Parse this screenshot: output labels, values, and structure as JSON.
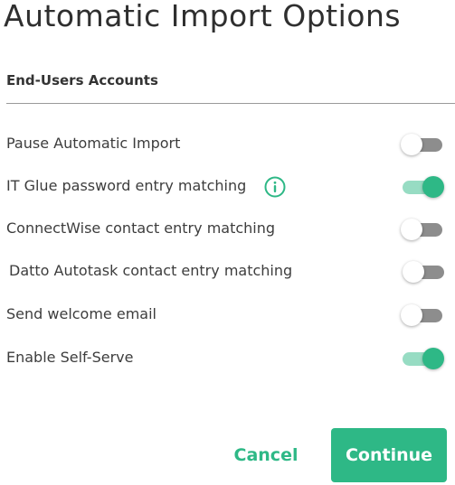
{
  "page": {
    "title": "Automatic Import Options",
    "section_heading": "End-Users Accounts"
  },
  "options": [
    {
      "label": "Pause Automatic Import",
      "state": "off"
    },
    {
      "label": "IT Glue password entry matching",
      "state": "on",
      "info_icon": "info-icon"
    },
    {
      "label": "ConnectWise contact entry matching",
      "state": "off"
    },
    {
      "label": "Datto Autotask contact entry matching",
      "state": "off"
    },
    {
      "label": "Send welcome email",
      "state": "off"
    },
    {
      "label": "Enable Self-Serve",
      "state": "on"
    }
  ],
  "actions": {
    "cancel_label": "Cancel",
    "continue_label": "Continue"
  },
  "colors": {
    "accent": "#2eb886",
    "accent_light": "#97dcc3",
    "toggle_off_track": "#8d8d8d"
  }
}
